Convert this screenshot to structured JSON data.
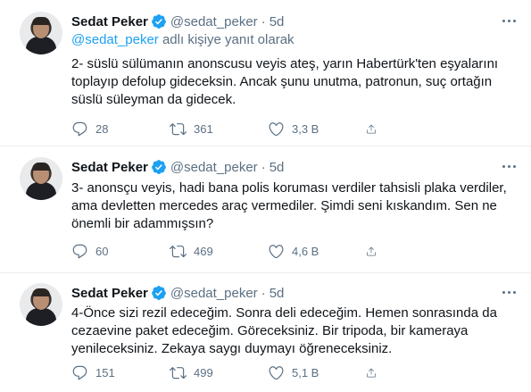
{
  "tweets": [
    {
      "name": "Sedat Peker",
      "handle": "@sedat_peker",
      "dot": "·",
      "time": "5d",
      "reply_handle": "@sedat_peker",
      "reply_suffix": " adlı kişiye yanıt olarak",
      "lines": [
        "2- süslü sülümanın anonscusu veyis ateş, yarın Habertürk'ten eşyalarını",
        "toplayıp defolup gideceksin. Ancak şunu unutma, patronun, suç ortağın",
        "süslü süleyman da gidecek."
      ],
      "replies": "28",
      "retweets": "361",
      "likes": "3,3 B"
    },
    {
      "name": "Sedat Peker",
      "handle": "@sedat_peker",
      "dot": "·",
      "time": "5d",
      "lines": [
        "3- anonsçu veyis, hadi bana polis koruması verdiler tahsisli plaka verdiler,",
        "ama devletten mercedes araç vermediler. Şimdi seni kıskandım. Sen ne",
        "önemli bir adammışsın?"
      ],
      "replies": "60",
      "retweets": "469",
      "likes": "4,6 B"
    },
    {
      "name": "Sedat Peker",
      "handle": "@sedat_peker",
      "dot": "·",
      "time": "5d",
      "lines": [
        "4-Önce sizi rezil edeceğim. Sonra deli edeceğim. Hemen sonrasında da",
        "cezaevine paket edeceğim. Göreceksiniz. Bir tripoda, bir kameraya",
        "yenileceksiniz. Zekaya saygı duymayı öğreneceksiniz."
      ],
      "replies": "151",
      "retweets": "499",
      "likes": "5,1 B"
    }
  ],
  "colors": {
    "text": "#0f1419",
    "secondary": "#5b7083",
    "link": "#1da1f2",
    "verified": "#1da1f2",
    "divider": "#ebeef0"
  },
  "icons": [
    "verified-badge-icon",
    "more-icon",
    "reply-icon",
    "retweet-icon",
    "like-icon",
    "share-icon"
  ]
}
